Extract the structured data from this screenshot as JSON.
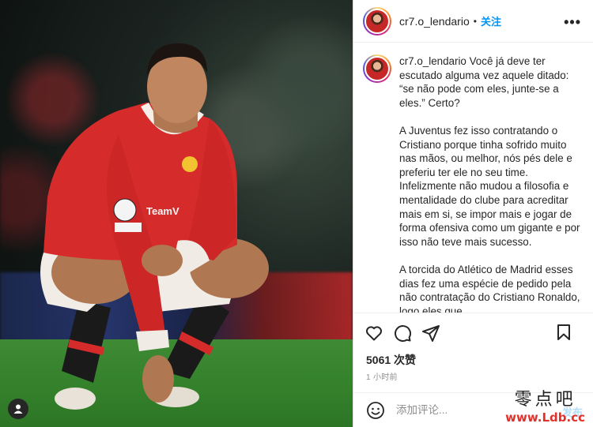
{
  "post": {
    "username": "cr7.o_lendario",
    "separator": "•",
    "follow_label": "关注",
    "more_label": "•••"
  },
  "caption": {
    "username": "cr7.o_lendario",
    "paragraphs": [
      "Você já deve ter escutado alguma vez aquele ditado: “se não pode com eles, junte-se a eles.” Certo?",
      "A Juventus fez isso contratando o Cristiano porque tinha sofrido muito nas mãos, ou melhor, nós pés dele e preferiu ter ele no seu time. Infelizmente não mudou a filosofia e mentalidade do clube para acreditar mais em si, se impor mais e jogar de forma ofensiva como um gigante e por isso não teve mais sucesso.",
      "A torcida do Atlético de Madrid esses dias fez uma espécie de pedido pela não contratação do Cristiano Ronaldo, logo eles que"
    ]
  },
  "stats": {
    "likes": "5061 次赞",
    "time": "1 小时前"
  },
  "comment": {
    "placeholder": "添加评论...",
    "post_label": "发布"
  },
  "icons": {
    "like": "heart-icon",
    "comment": "comment-icon",
    "share": "share-icon",
    "save": "bookmark-icon",
    "emoji": "emoji-icon",
    "profile": "user-tag-icon"
  },
  "watermark": {
    "text": "零点吧",
    "url": "www.Ldb.cc"
  },
  "colors": {
    "accent": "#0095f6",
    "jersey": "#d62b2b",
    "text": "#262626",
    "muted": "#8e8e8e"
  }
}
